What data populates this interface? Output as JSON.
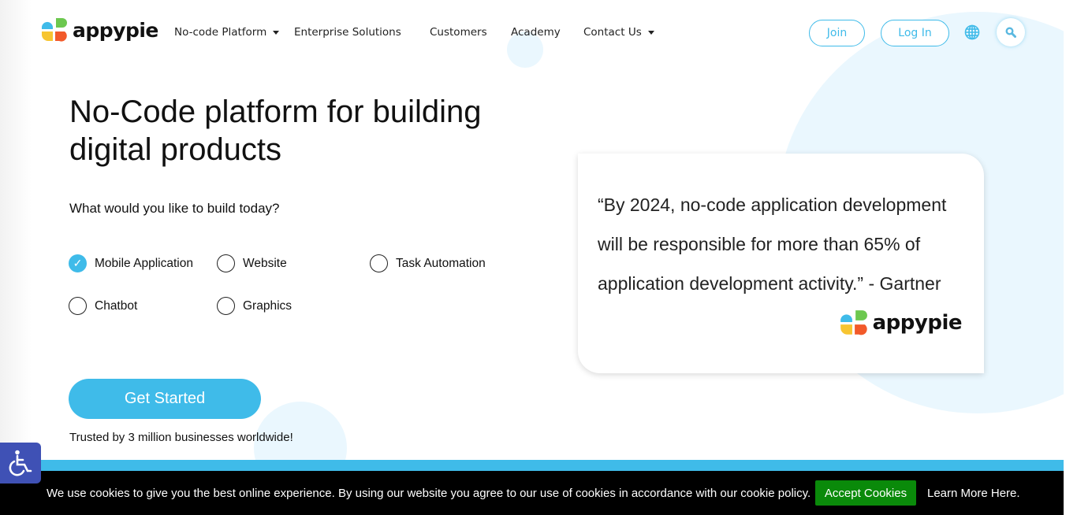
{
  "brand": {
    "name": "appypie",
    "accent": "#3fbbe9"
  },
  "nav": {
    "items": [
      {
        "label": "No-code Platform",
        "dropdown": true
      },
      {
        "label": "Enterprise Solutions"
      },
      {
        "label": "Customers"
      },
      {
        "label": "Academy"
      },
      {
        "label": "Contact Us",
        "dropdown": true
      }
    ],
    "join": "Join",
    "login": "Log In",
    "globe_icon": "globe-icon",
    "search_icon": "search-icon"
  },
  "hero": {
    "title": "No-Code platform for building digital products",
    "question": "What would you like to build today?",
    "options": [
      {
        "label": "Mobile Application",
        "checked": true
      },
      {
        "label": "Website",
        "checked": false
      },
      {
        "label": "Task Automation",
        "checked": false
      },
      {
        "label": "Chatbot",
        "checked": false
      },
      {
        "label": "Graphics",
        "checked": false
      }
    ],
    "cta": "Get Started",
    "trust": "Trusted by 3 million businesses worldwide!"
  },
  "quote": {
    "text": "“By 2024, no-code application development will be responsible for more than 65% of application development activity.” - Gartner",
    "logo": "appypie"
  },
  "cookie": {
    "message": "We use cookies to give you the best online experience. By using our website you agree to our use of cookies in accordance with our cookie policy.",
    "accept": "Accept Cookies",
    "learn": "Learn More Here."
  },
  "accessibility_icon": "wheelchair-icon"
}
